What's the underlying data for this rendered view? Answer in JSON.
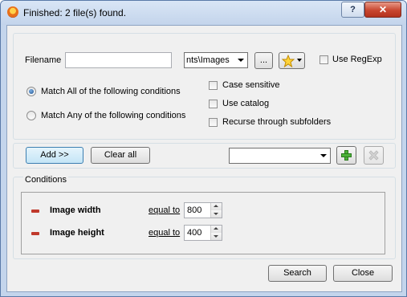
{
  "window": {
    "title": "Finished: 2 file(s) found.",
    "help_label": "?",
    "close_label": "✕"
  },
  "search": {
    "filename_label": "Filename",
    "filename_value": "",
    "folder_value": "nts\\Images",
    "browse_label": "...",
    "use_regexp_label": "Use RegExp",
    "match_all_label": "Match All of the following conditions",
    "match_any_label": "Match Any of the following conditions",
    "case_sensitive_label": "Case sensitive",
    "use_catalog_label": "Use catalog",
    "recurse_label": "Recurse through subfolders"
  },
  "toolbar": {
    "add_label": "Add >>",
    "clear_all_label": "Clear all",
    "preset_value": ""
  },
  "conditions": {
    "group_label": "Conditions",
    "items": [
      {
        "name": "Image width",
        "operator": "equal to",
        "value": "800"
      },
      {
        "name": "Image height",
        "operator": "equal to",
        "value": "400"
      }
    ]
  },
  "footer": {
    "search_label": "Search",
    "close_label": "Close"
  },
  "icons": {
    "app": "app-icon",
    "favorites": "star-icon",
    "add_preset": "plus-icon",
    "delete_preset": "cross-icon",
    "remove_condition": "minus-icon"
  },
  "colors": {
    "titlebar": "#c4d5ec",
    "close_button": "#c8462f",
    "plus_icon": "#3a9a2a",
    "remove_icon": "#c0392b"
  }
}
